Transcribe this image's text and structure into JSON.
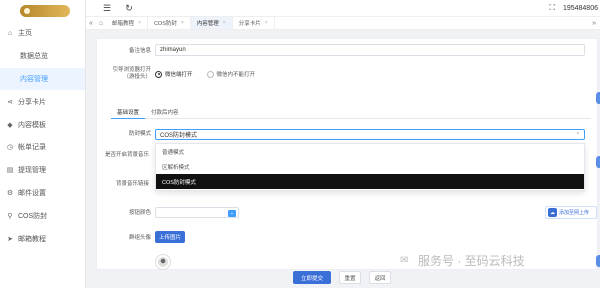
{
  "sidebar": {
    "items": [
      {
        "label": "主页",
        "icon": "home-icon",
        "glyph": "⌂",
        "sub": false,
        "active": false
      },
      {
        "label": "数据总览",
        "icon": "",
        "glyph": "",
        "sub": true,
        "active": false
      },
      {
        "label": "内容管理",
        "icon": "",
        "glyph": "",
        "sub": true,
        "active": true
      },
      {
        "label": "分享卡片",
        "icon": "share-icon",
        "glyph": "⋖",
        "sub": false,
        "active": false
      },
      {
        "label": "内容模板",
        "icon": "template-icon",
        "glyph": "◆",
        "sub": false,
        "active": false
      },
      {
        "label": "帐单记录",
        "icon": "bill-icon",
        "glyph": "◷",
        "sub": false,
        "active": false
      },
      {
        "label": "提现管理",
        "icon": "withdraw-icon",
        "glyph": "▤",
        "sub": false,
        "active": false
      },
      {
        "label": "邮件设置",
        "icon": "mail-settings-icon",
        "glyph": "⚙",
        "sub": false,
        "active": false
      },
      {
        "label": "COS防封",
        "icon": "link-icon",
        "glyph": "⚲",
        "sub": false,
        "active": false
      },
      {
        "label": "邮箱教程",
        "icon": "send-icon",
        "glyph": "➤",
        "sub": false,
        "active": false
      }
    ]
  },
  "header": {
    "menu_icon": "☰",
    "refresh_icon": "↻",
    "fullscreen_icon": "⛶",
    "phone": "195484806"
  },
  "tabs": {
    "left_icon": "«",
    "right_icon": "»",
    "items": [
      {
        "label": "邮箱教程",
        "active": false
      },
      {
        "label": "COS防封",
        "active": false
      },
      {
        "label": "内容管理",
        "active": true
      },
      {
        "label": "分享卡片",
        "active": false
      }
    ],
    "close": "×"
  },
  "form": {
    "remark_label": "备注信息",
    "remark_value": "zhimayun",
    "open_label": "引导浏览器打开（游投头）",
    "open_options": [
      "微信端打开",
      "微信内不能打开"
    ],
    "subtabs": [
      "基础设置",
      "付款后内容"
    ],
    "mode_label": "防封模式",
    "mode_value": "COS防封模式",
    "mode_options": [
      "普通模式",
      "区解析模式",
      "COS防封模式"
    ],
    "music_label": "是否开启背景音乐",
    "music_link_label": "背景音乐链接",
    "color_label": "按钮颜色",
    "color_value": "#409eff",
    "avatar_label": "群组头像",
    "upload_button": "上传图片",
    "upload_badge": "添加至网上传",
    "submit": "立即提交",
    "reset": "重置",
    "back": "返回"
  },
  "watermark": "服务号 · 至码云科技"
}
